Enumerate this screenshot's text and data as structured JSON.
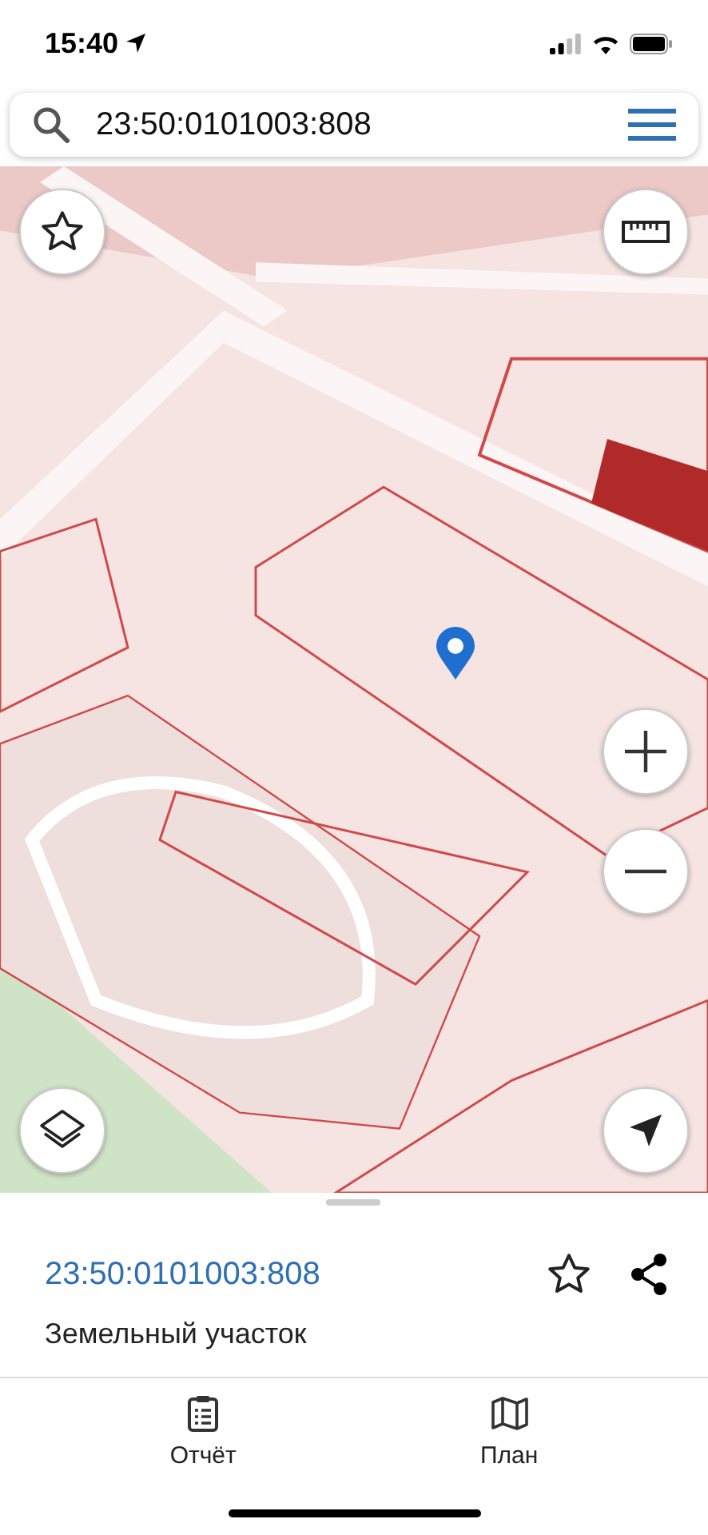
{
  "status_bar": {
    "time": "15:40"
  },
  "search": {
    "value": "23:50:0101003:808"
  },
  "parcel": {
    "number": "23:50:0101003:808",
    "type": "Земельный участок"
  },
  "tabs": [
    {
      "label": "Отчёт",
      "kind": "report"
    },
    {
      "label": "План",
      "kind": "plan"
    }
  ]
}
